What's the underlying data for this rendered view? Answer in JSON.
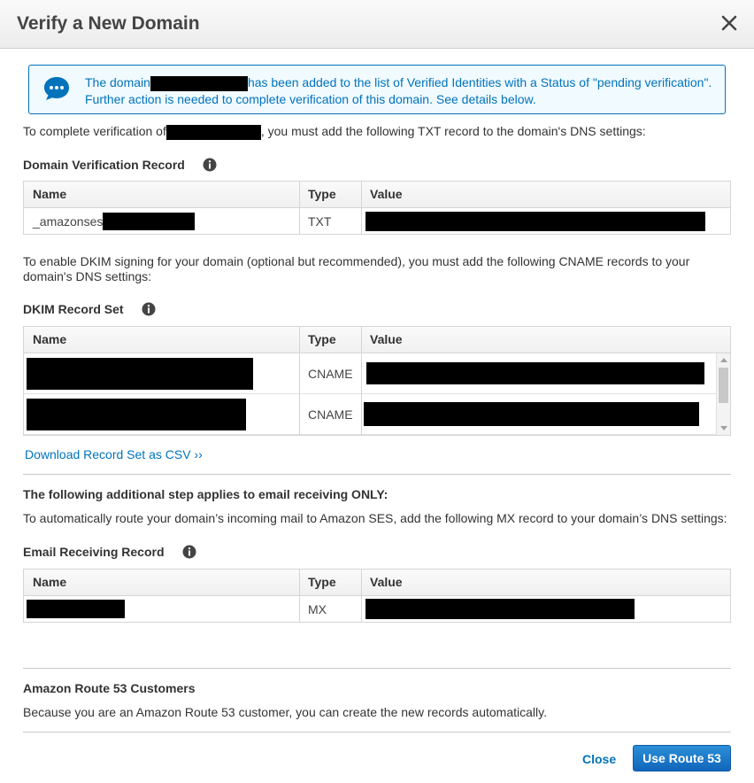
{
  "dialog": {
    "title": "Verify a New Domain",
    "close_icon": "close-icon"
  },
  "banner": {
    "icon": "chat-bubble-icon",
    "text_before": "The domain",
    "text_after": "has been added to the list of Verified Identities with a Status of \"pending verification\".",
    "text_line2": "Further action is needed to complete verification of this domain. See details below.",
    "color": "#0073bb"
  },
  "intro": {
    "before": "To complete verification of",
    "after": ", you must add the following TXT record to the domain's DNS settings:"
  },
  "verification": {
    "title": "Domain Verification Record",
    "headers": {
      "name": "Name",
      "type": "Type",
      "value": "Value"
    },
    "rows": [
      {
        "name": "_amazonses",
        "type": "TXT"
      }
    ]
  },
  "dkim_intro": "To enable DKIM signing for your domain (optional but recommended), you must add the following CNAME records to your domain's DNS settings:",
  "dkim": {
    "title": "DKIM Record Set",
    "headers": {
      "name": "Name",
      "type": "Type",
      "value": "Value"
    },
    "rows": [
      {
        "type": "CNAME"
      },
      {
        "type": "CNAME"
      }
    ],
    "download_link": "Download Record Set as CSV ››"
  },
  "receiving": {
    "step_title": "The following additional step applies to email receiving ONLY:",
    "step_text": "To automatically route your domain’s incoming mail to Amazon SES, add the following MX record to your domain’s DNS settings:",
    "title": "Email Receiving Record",
    "headers": {
      "name": "Name",
      "type": "Type",
      "value": "Value"
    },
    "rows": [
      {
        "type": "MX"
      }
    ]
  },
  "route53": {
    "title": "Amazon Route 53 Customers",
    "text": "Because you are an Amazon Route 53 customer, you can create the new records automatically."
  },
  "footer": {
    "close_label": "Close",
    "primary_label": "Use Route 53",
    "primary_color": "#1a78c8"
  }
}
